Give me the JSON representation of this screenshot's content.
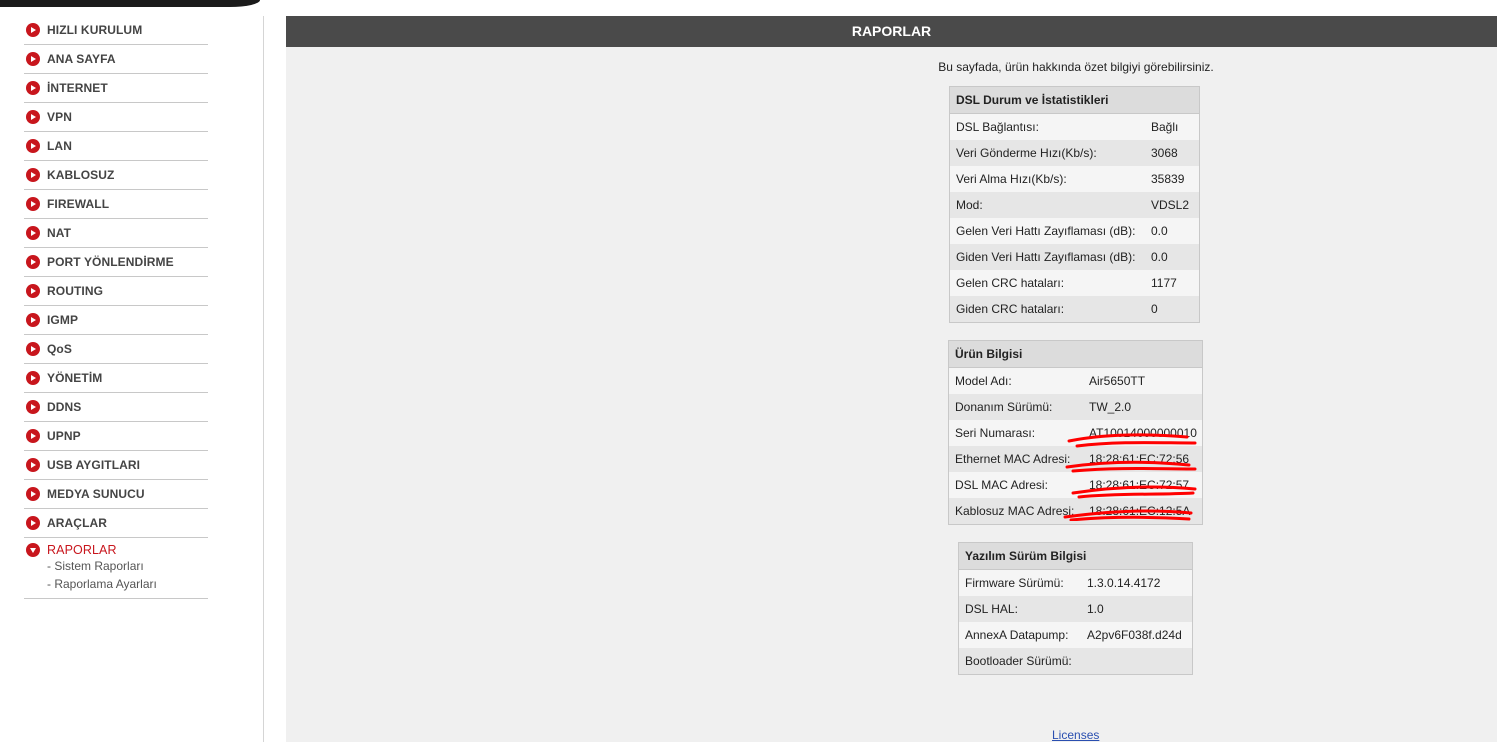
{
  "sidebar": {
    "items": [
      {
        "label": "HIZLI KURULUM"
      },
      {
        "label": "ANA SAYFA"
      },
      {
        "label": "İNTERNET"
      },
      {
        "label": "VPN"
      },
      {
        "label": "LAN"
      },
      {
        "label": "KABLOSUZ"
      },
      {
        "label": "FIREWALL"
      },
      {
        "label": "NAT"
      },
      {
        "label": "PORT YÖNLENDİRME"
      },
      {
        "label": "ROUTING"
      },
      {
        "label": "IGMP"
      },
      {
        "label": "QoS"
      },
      {
        "label": "YÖNETİM"
      },
      {
        "label": "DDNS"
      },
      {
        "label": "UPNP"
      },
      {
        "label": "USB AYGITLARI"
      },
      {
        "label": "MEDYA SUNUCU"
      },
      {
        "label": "ARAÇLAR"
      }
    ],
    "active": {
      "label": "RAPORLAR",
      "subitems": [
        {
          "label": "- Sistem Raporları"
        },
        {
          "label": "- Raporlama Ayarları"
        }
      ]
    }
  },
  "main": {
    "title": "RAPORLAR",
    "intro": "Bu sayfada, ürün hakkında özet bilgiyi görebilirsiniz.",
    "dsl": {
      "title": "DSL Durum ve İstatistikleri",
      "rows": [
        {
          "key": "DSL Bağlantısı:",
          "value": "Bağlı"
        },
        {
          "key": "Veri Gönderme Hızı(Kb/s):",
          "value": "3068"
        },
        {
          "key": "Veri Alma Hızı(Kb/s):",
          "value": "35839"
        },
        {
          "key": "Mod:",
          "value": "VDSL2"
        },
        {
          "key": "Gelen Veri Hattı Zayıflaması (dB):",
          "value": "0.0"
        },
        {
          "key": "Giden Veri Hattı Zayıflaması (dB):",
          "value": "0.0"
        },
        {
          "key": "Gelen CRC hataları:",
          "value": "1177"
        },
        {
          "key": "Giden CRC hataları:",
          "value": "0"
        }
      ]
    },
    "product": {
      "title": "Ürün Bilgisi",
      "rows": [
        {
          "key": "Model Adı:",
          "value": "Air5650TT"
        },
        {
          "key": "Donanım Sürümü:",
          "value": "TW_2.0"
        },
        {
          "key": "Seri Numarası:",
          "value": "AT10014000000010"
        },
        {
          "key": "Ethernet MAC Adresi:",
          "value": "18:28:61:EC:72:56"
        },
        {
          "key": "DSL MAC Adresi:",
          "value": "18:28:61:EC:72:57"
        },
        {
          "key": "Kablosuz MAC Adresi:",
          "value": "18:28:61:EC:12:5A"
        }
      ]
    },
    "software": {
      "title": "Yazılım Sürüm Bilgisi",
      "rows": [
        {
          "key": "Firmware Sürümü:",
          "value": "1.3.0.14.4172"
        },
        {
          "key": "DSL HAL:",
          "value": "1.0"
        },
        {
          "key": "AnnexA Datapump:",
          "value": "A2pv6F038f.d24d"
        },
        {
          "key": "Bootloader Sürümü:",
          "value": ""
        }
      ]
    },
    "licenses_link": "Licenses"
  },
  "colors": {
    "accent": "#c8161d",
    "header_bg": "#4a4a4a",
    "main_bg": "#f0f0f0",
    "redaction": "#ff0000",
    "link": "#2a4fb0"
  }
}
